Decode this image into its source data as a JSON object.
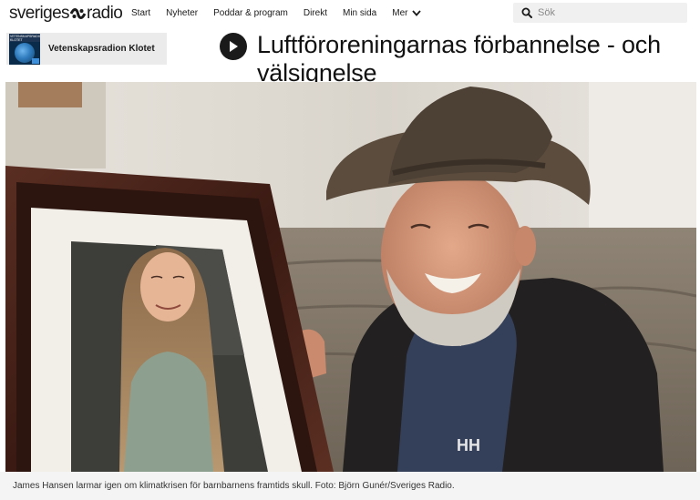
{
  "header": {
    "logo": {
      "left_text": "sveriges",
      "right_text": "radio",
      "mark_icon": "sr-logo-mark"
    },
    "nav": [
      {
        "label": "Start"
      },
      {
        "label": "Nyheter"
      },
      {
        "label": "Poddar & program"
      },
      {
        "label": "Direkt"
      },
      {
        "label": "Min sida"
      },
      {
        "label": "Mer",
        "icon": "chevron-down-icon"
      }
    ],
    "search": {
      "placeholder": "Sök",
      "value": "",
      "icon": "search-icon"
    }
  },
  "program": {
    "title": "Vetenskapsradion Klotet",
    "thumb_text": "VETENSKAPSRADION KLOTET"
  },
  "article": {
    "headline": "Luftföroreningarnas förbannelse - och välsignelse",
    "play_icon": "play-icon",
    "image_caption": "James Hansen larmar igen om klimatkrisen för barnbarnens framtids skull. Foto: Björn Gunér/Sveriges Radio."
  },
  "colors": {
    "text": "#1a1a1a",
    "search_bg": "#f0f0f0",
    "program_bg": "#ebebeb",
    "caption_bg": "#f4f4f4",
    "play_button": "#1a1a1a"
  }
}
